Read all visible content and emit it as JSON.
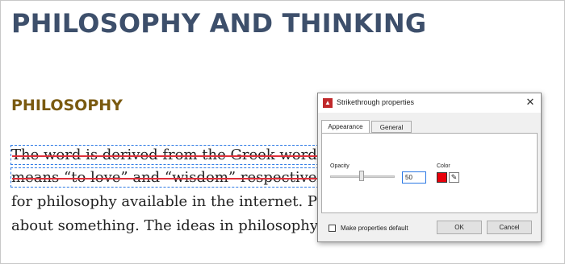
{
  "document": {
    "title": "PHILOSOPHY AND THINKING",
    "heading": "PHILOSOPHY",
    "lines": [
      "The word is derived from the Greek words Ph",
      "means “to love” and “wisdom” respectively. T",
      "for philosophy available in the internet. Phil",
      "about something. The ideas in philosophy ar"
    ]
  },
  "dialog": {
    "title": "Strikethrough properties",
    "close_icon": "close-icon",
    "tabs": [
      {
        "label": "Appearance",
        "active": true
      },
      {
        "label": "General",
        "active": false
      }
    ],
    "opacity": {
      "label": "Opacity",
      "value": "50",
      "level_percent": 50
    },
    "color": {
      "label": "Color",
      "value": "#e8000b"
    },
    "make_default": {
      "label": "Make properties default",
      "checked": false
    },
    "ok_label": "OK",
    "cancel_label": "Cancel"
  }
}
